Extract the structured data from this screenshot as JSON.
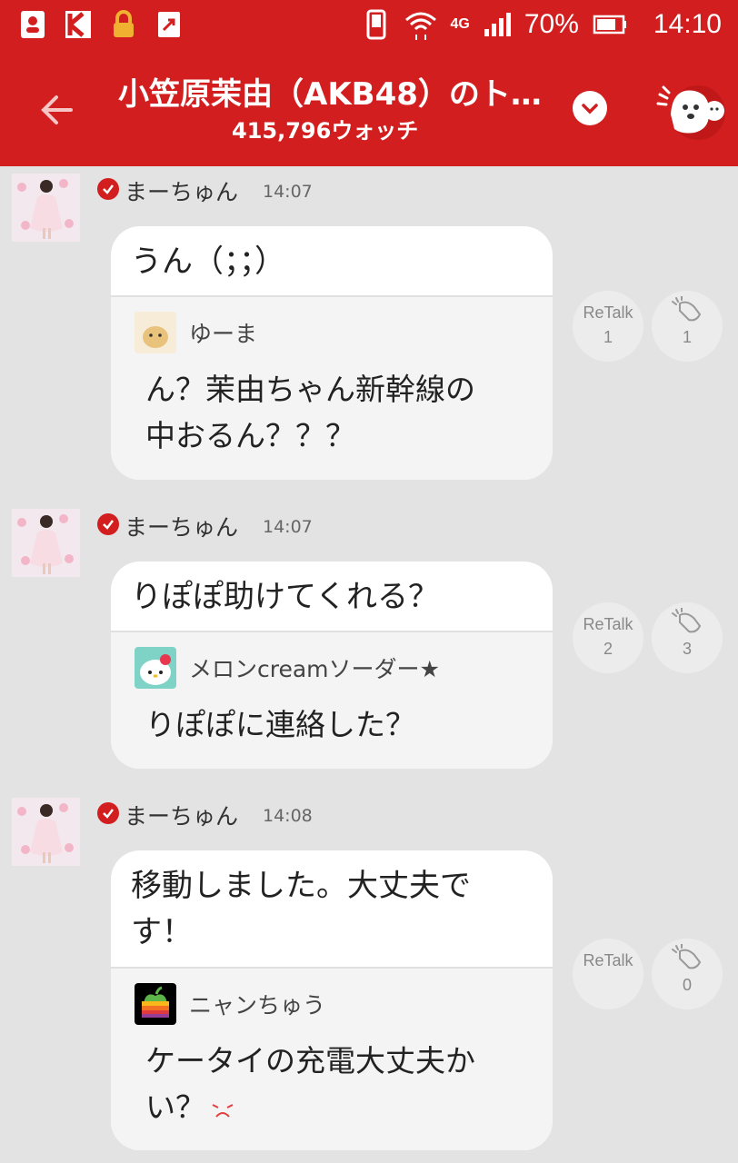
{
  "status_bar": {
    "battery": "70%",
    "time": "14:10",
    "network": "4G"
  },
  "header": {
    "title": "小笠原茉由（AKB48）のト…",
    "watch_count": "415,796ウォッチ",
    "back_icon": "arrow-left-icon",
    "dropdown_icon": "chevron-down-icon"
  },
  "messages": [
    {
      "author": "まーちゅん",
      "time": "14:07",
      "text": "うん（；；）",
      "reply": {
        "name": "ゆーま",
        "text_line1": "ん？茉由ちゃん新幹線の",
        "text_line2": "中おるん？？？"
      },
      "retalk_label": "ReTalk",
      "retalk_count": "1",
      "clap_count": "1"
    },
    {
      "author": "まーちゅん",
      "time": "14:07",
      "text": "りぽぽ助けてくれる？",
      "reply": {
        "name": "メロンcreamソーダー★",
        "text_line1": "りぽぽに連絡した？",
        "text_line2": ""
      },
      "retalk_label": "ReTalk",
      "retalk_count": "2",
      "clap_count": "3"
    },
    {
      "author": "まーちゅん",
      "time": "14:08",
      "text_line1": "移動しました。大丈夫で",
      "text_line2": "す！",
      "reply": {
        "name": "ニャンちゅう",
        "text_line1": "ケータイの充電大丈夫か",
        "text_line2": "い？"
      },
      "retalk_label": "ReTalk",
      "retalk_count": "",
      "clap_count": "0"
    }
  ],
  "colors": {
    "brand_red": "#d21e1e",
    "background": "#e3e3e3"
  }
}
